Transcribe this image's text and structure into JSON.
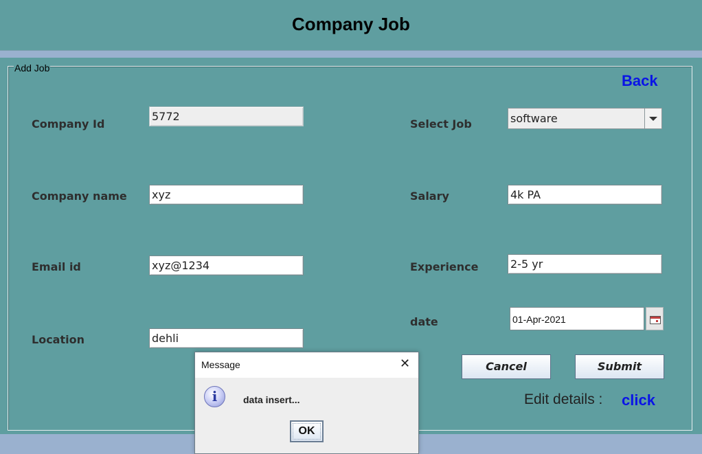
{
  "header": {
    "title": "Company Job"
  },
  "group": {
    "title": "Add Job"
  },
  "links": {
    "back": "Back",
    "click": "click",
    "edit_details_label": "Edit details :"
  },
  "form": {
    "company_id": {
      "label": "Company Id",
      "value": "5772"
    },
    "company_name": {
      "label": "Company name",
      "value": "xyz"
    },
    "email_id": {
      "label": "Email id",
      "value": "xyz@1234"
    },
    "location": {
      "label": "Location",
      "value": "dehli"
    },
    "select_job": {
      "label": "Select Job",
      "value": "software"
    },
    "salary": {
      "label": "Salary",
      "value": "4k PA"
    },
    "experience": {
      "label": "Experience",
      "value": "2-5 yr"
    },
    "date": {
      "label": "date",
      "value": "01-Apr-2021"
    }
  },
  "buttons": {
    "cancel": "Cancel",
    "submit": "Submit"
  },
  "dialog": {
    "title": "Message",
    "close_glyph": "✕",
    "icon_glyph": "i",
    "message": "data insert...",
    "ok": "OK"
  },
  "icons": {
    "combo_arrow": "chevron-down-icon",
    "date_picker": "calendar-icon",
    "dialog_info": "info-icon",
    "dialog_close": "close-icon"
  },
  "colors": {
    "panel": "#5f9ea0",
    "outer": "#9ab1cf",
    "link": "#0a14e6"
  }
}
